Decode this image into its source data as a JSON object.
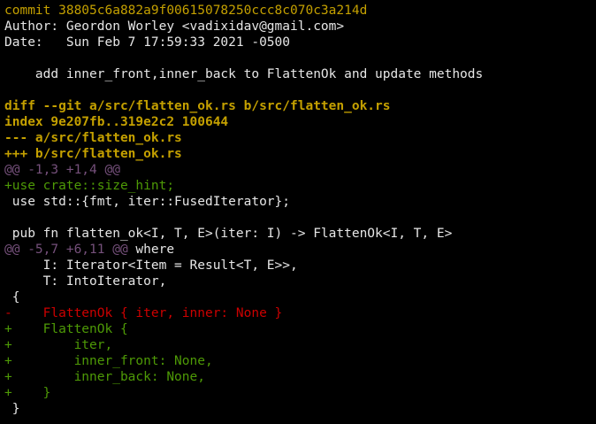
{
  "colors": {
    "background": "#000000",
    "normal": "#e6e6e6",
    "hash": "#c4a000",
    "meta": "#c4a000",
    "hunk": "#75507b",
    "add": "#4e9a06",
    "del": "#cc0000"
  },
  "lines": [
    {
      "name": "commit-line",
      "segments": [
        {
          "text": "commit 38805c6a882a9f00615078250ccc8c070c3a214d",
          "cls": "hash"
        }
      ]
    },
    {
      "name": "author-line",
      "segments": [
        {
          "text": "Author: Geordon Worley <vadixidav@gmail.com>",
          "cls": "normal"
        }
      ]
    },
    {
      "name": "date-line",
      "segments": [
        {
          "text": "Date:   Sun Feb 7 17:59:33 2021 -0500",
          "cls": "normal"
        }
      ]
    },
    {
      "name": "blank-line",
      "segments": [
        {
          "text": "",
          "cls": "normal"
        }
      ]
    },
    {
      "name": "commit-message-line",
      "segments": [
        {
          "text": "    add inner_front,inner_back to FlattenOk and update methods",
          "cls": "normal"
        }
      ]
    },
    {
      "name": "blank-line",
      "segments": [
        {
          "text": "",
          "cls": "normal"
        }
      ]
    },
    {
      "name": "diff-header-line",
      "segments": [
        {
          "text": "diff --git a/src/flatten_ok.rs b/src/flatten_ok.rs",
          "cls": "meta"
        }
      ]
    },
    {
      "name": "index-line",
      "segments": [
        {
          "text": "index 9e207fb..319e2c2 100644",
          "cls": "meta"
        }
      ]
    },
    {
      "name": "old-file-line",
      "segments": [
        {
          "text": "--- a/src/flatten_ok.rs",
          "cls": "meta"
        }
      ]
    },
    {
      "name": "new-file-line",
      "segments": [
        {
          "text": "+++ b/src/flatten_ok.rs",
          "cls": "meta"
        }
      ]
    },
    {
      "name": "hunk-header-line",
      "segments": [
        {
          "text": "@@ -1,3 +1,4 @@",
          "cls": "hunk"
        }
      ]
    },
    {
      "name": "added-line",
      "segments": [
        {
          "text": "+use crate::size_hint;",
          "cls": "add"
        }
      ]
    },
    {
      "name": "context-line",
      "segments": [
        {
          "text": " use std::{fmt, iter::FusedIterator};",
          "cls": "normal"
        }
      ]
    },
    {
      "name": "context-line",
      "segments": [
        {
          "text": "",
          "cls": "normal"
        }
      ]
    },
    {
      "name": "context-line",
      "segments": [
        {
          "text": " pub fn flatten_ok<I, T, E>(iter: I) -> FlattenOk<I, T, E>",
          "cls": "normal"
        }
      ]
    },
    {
      "name": "hunk-header-line",
      "segments": [
        {
          "text": "@@ -5,7 +6,11 @@",
          "cls": "hunk"
        },
        {
          "text": " where",
          "cls": "normal"
        }
      ]
    },
    {
      "name": "context-line",
      "segments": [
        {
          "text": "     I: Iterator<Item = Result<T, E>>,",
          "cls": "normal"
        }
      ]
    },
    {
      "name": "context-line",
      "segments": [
        {
          "text": "     T: IntoIterator,",
          "cls": "normal"
        }
      ]
    },
    {
      "name": "context-line",
      "segments": [
        {
          "text": " {",
          "cls": "normal"
        }
      ]
    },
    {
      "name": "removed-line",
      "segments": [
        {
          "text": "-    FlattenOk { iter, inner: None }",
          "cls": "del"
        }
      ]
    },
    {
      "name": "added-line",
      "segments": [
        {
          "text": "+    FlattenOk {",
          "cls": "add"
        }
      ]
    },
    {
      "name": "added-line",
      "segments": [
        {
          "text": "+        iter,",
          "cls": "add"
        }
      ]
    },
    {
      "name": "added-line",
      "segments": [
        {
          "text": "+        inner_front: None,",
          "cls": "add"
        }
      ]
    },
    {
      "name": "added-line",
      "segments": [
        {
          "text": "+        inner_back: None,",
          "cls": "add"
        }
      ]
    },
    {
      "name": "added-line",
      "segments": [
        {
          "text": "+    }",
          "cls": "add"
        }
      ]
    },
    {
      "name": "context-line",
      "segments": [
        {
          "text": " }",
          "cls": "normal"
        }
      ]
    }
  ]
}
